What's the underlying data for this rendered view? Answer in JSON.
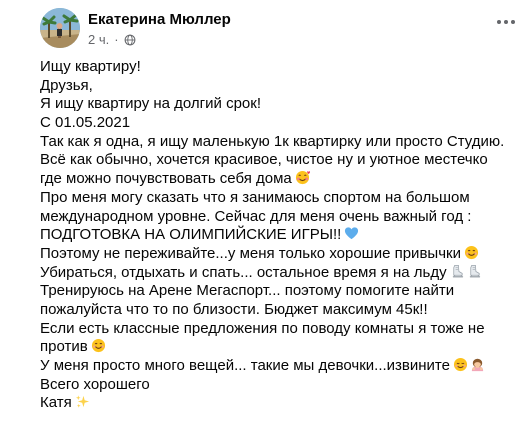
{
  "author": {
    "name": "Екатерина Мюллер",
    "time": "2 ч.",
    "separator": "·"
  },
  "post": {
    "lines": [
      {
        "text": "Ищу квартиру!",
        "emojis": []
      },
      {
        "text": "Друзья,",
        "emojis": []
      },
      {
        "text": "Я ищу квартиру на долгий срок!",
        "emojis": []
      },
      {
        "text": "С 01.05.2021",
        "emojis": []
      },
      {
        "text": "Так как я одна,  я ищу маленькую 1к квартирку или просто Студию.",
        "emojis": []
      },
      {
        "text": "Всё как обычно, хочется красивое, чистое ну и уютное местечко",
        "emojis": []
      },
      {
        "text": "где можно почувствовать себя дома",
        "emojis": [
          "smiling-face-with-hearts-emoji"
        ]
      },
      {
        "text": "Про меня могу сказать что я занимаюсь спортом на большом",
        "emojis": []
      },
      {
        "text": "международном уровне. Сейчас для меня очень важный год :",
        "emojis": []
      },
      {
        "text": "ПОДГОТОВКА НА ОЛИМПИЙСКИЕ ИГРЫ!!",
        "emojis": [
          "blue-heart-emoji"
        ]
      },
      {
        "text": "Поэтому не переживайте...у меня только хорошие привычки",
        "emojis": [
          "smiling-face-emoji"
        ]
      },
      {
        "text": "Убираться, отдыхать и спать... остальное время я на льду",
        "emojis": [
          "ice-skate-emoji",
          "ice-skate-emoji"
        ]
      },
      {
        "text": "Тренируюсь на Арене Мегаспорт... поэтому помогите найти",
        "emojis": []
      },
      {
        "text": "пожалуйста что то по близости. Бюджет максимум 45к!!",
        "emojis": []
      },
      {
        "text": "Если есть классные предложения по поводу комнаты я тоже не",
        "emojis": []
      },
      {
        "text": "против",
        "emojis": [
          "smiling-face-emoji"
        ]
      },
      {
        "text": "У меня просто много вещей... такие мы девочки...извините",
        "emojis": [
          "relieved-face-emoji",
          "woman-bowing-emoji"
        ]
      },
      {
        "text": "Всего хорошего",
        "emojis": []
      },
      {
        "text": "Катя",
        "emojis": [
          "sparkles-emoji"
        ]
      }
    ]
  },
  "colors": {
    "text": "#050505",
    "secondary": "#65676b",
    "background": "#ffffff",
    "blue_heart": "#5dadec",
    "emoji_yellow": "#fcc21b"
  }
}
